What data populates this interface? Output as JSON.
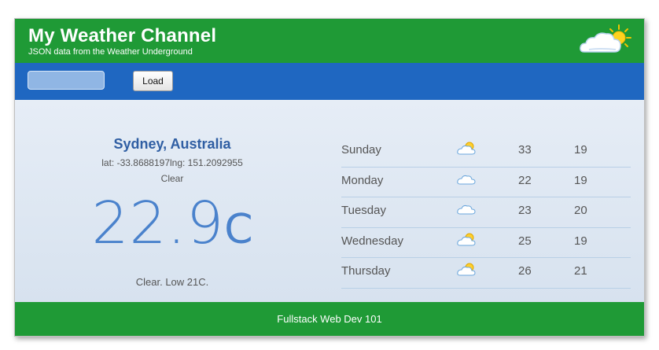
{
  "header": {
    "title": "My Weather Channel",
    "subtitle": "JSON data from the Weather Underground",
    "logo_icon": "sun-cloud-icon"
  },
  "toolbar": {
    "location_value": "",
    "location_placeholder": "",
    "load_label": "Load"
  },
  "current": {
    "city": "Sydney, Australia",
    "coords": "lat: -33.8688197lng: 151.2092955",
    "condition": "Clear",
    "temperature": "22.9",
    "unit": "C",
    "summary": "Clear. Low 21C."
  },
  "forecast": [
    {
      "day": "Sunday",
      "icon": "partly-sunny-icon",
      "high": "33",
      "low": "19"
    },
    {
      "day": "Monday",
      "icon": "cloud-icon",
      "high": "22",
      "low": "19"
    },
    {
      "day": "Tuesday",
      "icon": "cloud-icon",
      "high": "23",
      "low": "20"
    },
    {
      "day": "Wednesday",
      "icon": "partly-sunny-icon",
      "high": "25",
      "low": "19"
    },
    {
      "day": "Thursday",
      "icon": "partly-sunny-icon",
      "high": "26",
      "low": "21"
    }
  ],
  "footer": {
    "text": "Fullstack Web Dev 101"
  },
  "colors": {
    "header_green": "#1f9a36",
    "toolbar_blue": "#1f67c1",
    "city_blue": "#2f5ea3",
    "temp_blue": "#4a82cc"
  }
}
